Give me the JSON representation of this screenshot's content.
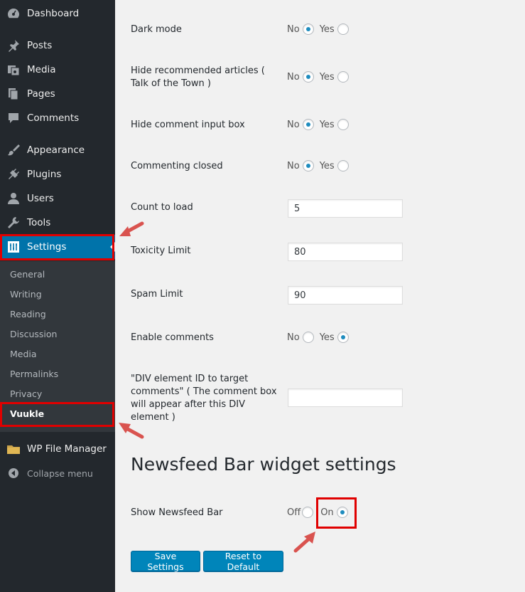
{
  "sidebar": {
    "items": [
      {
        "label": "Dashboard",
        "icon": "dashboard-icon"
      },
      {
        "label": "Posts",
        "icon": "pin-icon"
      },
      {
        "label": "Media",
        "icon": "media-icon"
      },
      {
        "label": "Pages",
        "icon": "pages-icon"
      },
      {
        "label": "Comments",
        "icon": "comment-icon"
      },
      {
        "label": "Appearance",
        "icon": "brush-icon"
      },
      {
        "label": "Plugins",
        "icon": "plugin-icon"
      },
      {
        "label": "Users",
        "icon": "user-icon"
      },
      {
        "label": "Tools",
        "icon": "wrench-icon"
      },
      {
        "label": "Settings",
        "icon": "settings-icon"
      }
    ],
    "submenu": [
      "General",
      "Writing",
      "Reading",
      "Discussion",
      "Media",
      "Permalinks",
      "Privacy",
      "Vuukle"
    ],
    "file_manager": "WP File Manager",
    "collapse": "Collapse menu"
  },
  "settings": {
    "dark_mode": {
      "label": "Dark mode",
      "no": "No",
      "yes": "Yes",
      "selected": "No"
    },
    "hide_recommended": {
      "label_line1": "Hide recommended articles (",
      "label_line2": "Talk of the Town )",
      "no": "No",
      "yes": "Yes",
      "selected": "No"
    },
    "hide_comment_input": {
      "label": "Hide comment input box",
      "no": "No",
      "yes": "Yes",
      "selected": "No"
    },
    "commenting_closed": {
      "label": "Commenting closed",
      "no": "No",
      "yes": "Yes",
      "selected": "No"
    },
    "count_to_load": {
      "label": "Count to load",
      "value": "5"
    },
    "toxicity_limit": {
      "label": "Toxicity Limit",
      "value": "80"
    },
    "spam_limit": {
      "label": "Spam Limit",
      "value": "90"
    },
    "enable_comments": {
      "label": "Enable comments",
      "no": "No",
      "yes": "Yes",
      "selected": "Yes"
    },
    "div_element": {
      "line1": "\"DIV element ID to target",
      "line2": "comments\" ( The comment box",
      "line3": "will appear after this DIV",
      "line4": "element )",
      "value": ""
    }
  },
  "newsfeed": {
    "heading": "Newsfeed Bar widget settings",
    "label": "Show Newsfeed Bar",
    "off": "Off",
    "on": "On",
    "selected": "On"
  },
  "buttons": {
    "save": "Save Settings",
    "reset": "Reset to Default"
  },
  "colors": {
    "sidebar": "#23282d",
    "active": "#0073aa",
    "highlight": "#e00000",
    "arrow": "#d9534f"
  }
}
